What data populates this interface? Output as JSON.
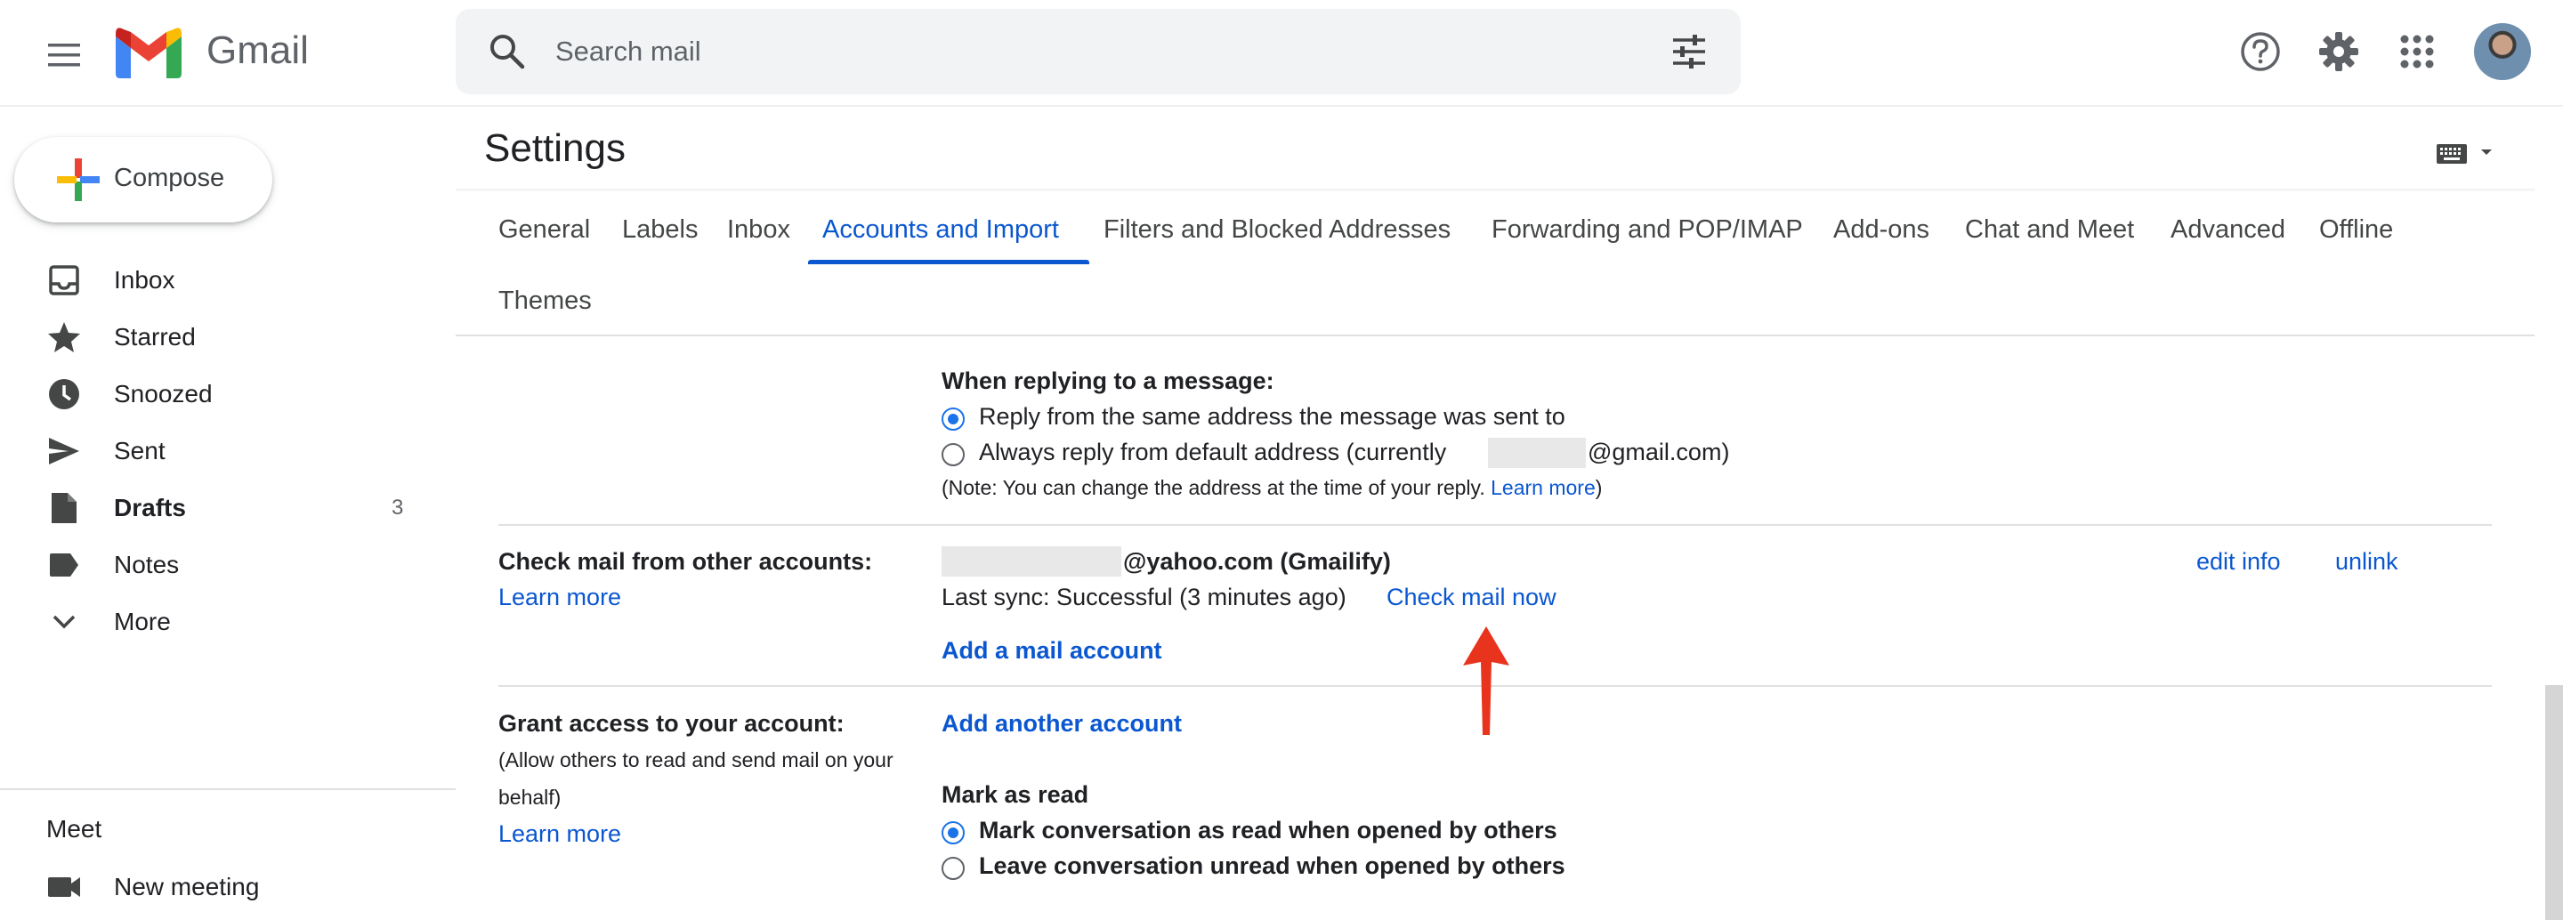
{
  "header": {
    "app_name": "Gmail",
    "search_placeholder": "Search mail"
  },
  "sidebar": {
    "compose_label": "Compose",
    "items": [
      {
        "label": "Inbox",
        "icon": "inbox-icon"
      },
      {
        "label": "Starred",
        "icon": "star-icon"
      },
      {
        "label": "Snoozed",
        "icon": "clock-icon"
      },
      {
        "label": "Sent",
        "icon": "send-icon"
      },
      {
        "label": "Drafts",
        "icon": "draft-icon",
        "count": "3"
      },
      {
        "label": "Notes",
        "icon": "label-icon"
      },
      {
        "label": "More",
        "icon": "chevron-down-icon"
      }
    ],
    "meet_title": "Meet",
    "meet_item": "New meeting"
  },
  "settings": {
    "title": "Settings",
    "tabs": [
      "General",
      "Labels",
      "Inbox",
      "Accounts and Import",
      "Filters and Blocked Addresses",
      "Forwarding and POP/IMAP",
      "Add-ons",
      "Chat and Meet",
      "Advanced",
      "Offline",
      "Themes"
    ],
    "active_tab": "Accounts and Import",
    "reply": {
      "heading": "When replying to a message:",
      "option1": "Reply from the same address the message was sent to",
      "option2_prefix": "Always reply from default address (currently",
      "option2_suffix": "@gmail.com)",
      "note_prefix": "(Note: You can change the address at the time of your reply.",
      "note_link": "Learn more",
      "note_suffix": ")",
      "selected": 1
    },
    "check_mail": {
      "label": "Check mail from other accounts:",
      "learn_more": "Learn more",
      "account_suffix": "@yahoo.com (Gmailify)",
      "sync_status": "Last sync: Successful (3 minutes ago)",
      "check_now": "Check mail now",
      "add_account": "Add a mail account",
      "edit_info": "edit info",
      "unlink": "unlink"
    },
    "grant_access": {
      "label": "Grant access to your account:",
      "description_line1": "(Allow others to read and send mail on your",
      "description_line2": "behalf)",
      "learn_more": "Learn more",
      "add_another": "Add another account",
      "mark_read_heading": "Mark as read",
      "option1": "Mark conversation as read when opened by others",
      "option2": "Leave conversation unread when opened by others",
      "selected": 1
    }
  },
  "colors": {
    "accent": "#0b57d0",
    "annotation_arrow": "#e8341c"
  }
}
